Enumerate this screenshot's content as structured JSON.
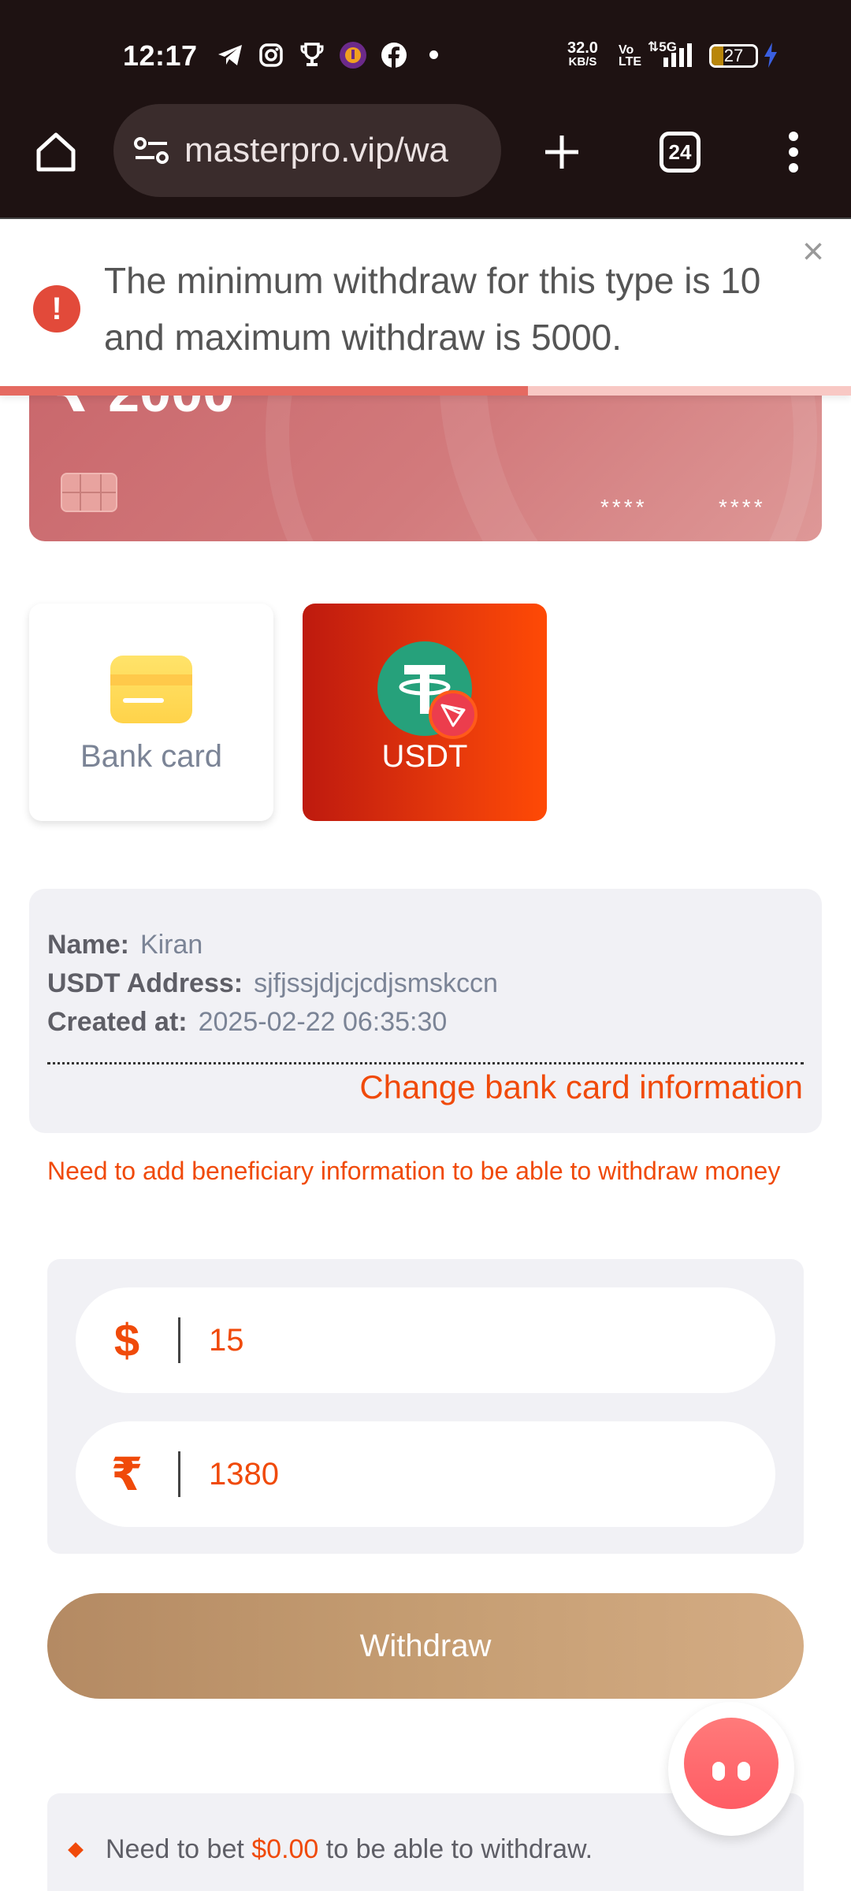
{
  "status_bar": {
    "time": "12:17",
    "net_speed_value": "32.0",
    "net_speed_unit": "KB/S",
    "volte_line1": "Vo",
    "volte_line2": "LTE",
    "network": "5G",
    "battery": "27"
  },
  "browser": {
    "url": "masterpro.vip/wa",
    "tab_count": "24"
  },
  "toast": {
    "message": "The minimum withdraw for this type is 10 and maximum withdraw is 5000.",
    "close": "×",
    "progress": 0.62
  },
  "card": {
    "balance": "₹ 2000",
    "masked_1": "****",
    "masked_2": "****"
  },
  "methods": [
    {
      "label": "Bank card",
      "selected": false
    },
    {
      "label": "USDT",
      "selected": true
    }
  ],
  "info": {
    "name_label": "Name:",
    "name_value": "Kiran",
    "address_label": "USDT Address:",
    "address_value": "sjfjssjdjcjcdjsmskccn",
    "created_label": "Created at:",
    "created_value": "2025-02-22 06:35:30",
    "change_link": "Change bank card information"
  },
  "warning": "Need to add beneficiary information to be able to withdraw money",
  "amounts": {
    "usd_symbol": "$",
    "usd_value": "15",
    "inr_symbol": "₹",
    "inr_value": "1380"
  },
  "withdraw_button": "Withdraw",
  "bet": {
    "prefix": "Need to bet",
    "amount": "$0.00",
    "suffix": "to be able to withdraw."
  },
  "colors": {
    "accent": "#f04a0a",
    "error": "#e24a3a",
    "usdt_green": "#26a17b"
  }
}
